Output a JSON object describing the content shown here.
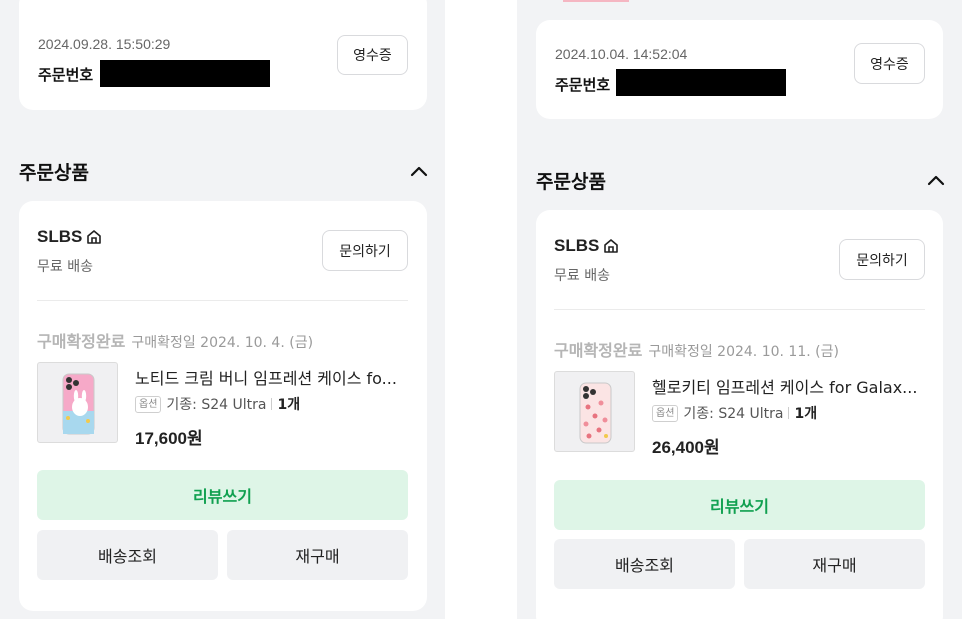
{
  "left": {
    "order_date": "2024.09.28. 15:50:29",
    "order_no_label": "주문번호",
    "receipt_button": "영수증",
    "section_title": "주문상품",
    "seller": "SLBS",
    "shipping": "무료 배송",
    "inquiry_button": "문의하기",
    "status": "구매확정완료",
    "confirm_date": "구매확정일 2024. 10. 4. (금)",
    "product_name": "노티드 크림 버니 임프레션 케이스 fo...",
    "option_badge": "옵션",
    "option_text": "기종: S24 Ultra",
    "quantity": "1개",
    "price": "17,600원",
    "review_button": "리뷰쓰기",
    "delivery_button": "배송조회",
    "rebuy_button": "재구매"
  },
  "right": {
    "order_date": "2024.10.04. 14:52:04",
    "order_no_label": "주문번호",
    "receipt_button": "영수증",
    "section_title": "주문상품",
    "seller": "SLBS",
    "shipping": "무료 배송",
    "inquiry_button": "문의하기",
    "status": "구매확정완료",
    "confirm_date": "구매확정일 2024. 10. 11. (금)",
    "product_name": "헬로키티 임프레션 케이스 for Galax...",
    "option_badge": "옵션",
    "option_text": "기종: S24 Ultra",
    "quantity": "1개",
    "price": "26,400원",
    "review_button": "리뷰쓰기",
    "delivery_button": "배송조회",
    "rebuy_button": "재구매"
  },
  "colors": {
    "background": "#f2f3f5",
    "review_bg": "#def5e7",
    "review_text": "#10a050",
    "status_text": "#b5b5b5"
  },
  "icons": [
    "home-icon",
    "chevron-up-icon"
  ]
}
